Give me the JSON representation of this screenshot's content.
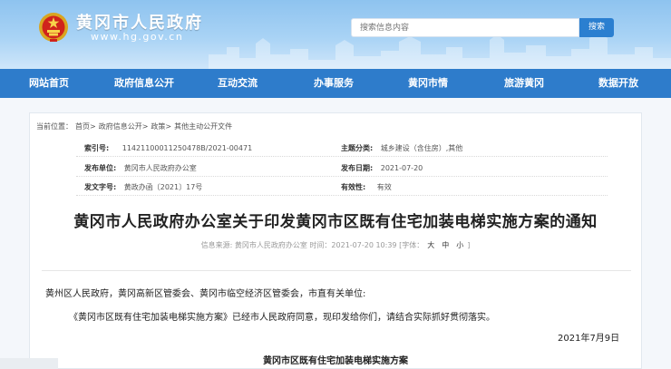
{
  "header": {
    "site_title": "黄冈市人民政府",
    "site_url": "www.hg.gov.cn",
    "search_placeholder": "搜索信息内容",
    "search_button": "搜索"
  },
  "nav": {
    "items": [
      "网站首页",
      "政府信息公开",
      "互动交流",
      "办事服务",
      "黄冈市情",
      "旅游黄冈",
      "数据开放"
    ]
  },
  "breadcrumb": {
    "prefix": "当前位置：",
    "items": [
      "首页>",
      "政府信息公开>",
      "政策>",
      "其他主动公开文件"
    ]
  },
  "meta": {
    "index_label": "索引号:",
    "index_value": "11421100011250478B/2021-00471",
    "topic_label": "主题分类:",
    "topic_value": "城乡建设（含住房）,其他",
    "issuer_label": "发布单位:",
    "issuer_value": "黄冈市人民政府办公室",
    "date_label": "发布日期:",
    "date_value": "2021-07-20",
    "docno_label": "发文字号:",
    "docno_value": "黄政办函〔2021〕17号",
    "validity_label": "有效性:",
    "validity_value": "有效"
  },
  "document": {
    "title": "黄冈市人民政府办公室关于印发黄冈市区既有住宅加装电梯实施方案的通知",
    "source": "信息来源:  黄冈市人民政府办公室   时间：2021-07-20 10:39  [字体：",
    "font_large": "大",
    "font_medium": "中",
    "font_small": "小",
    "font_close": "]",
    "salutation": "黄州区人民政府，黄冈高新区管委会、黄冈市临空经济区管委会，市直有关单位:",
    "paragraph": "《黄冈市区既有住宅加装电梯实施方案》已经市人民政府同意，现印发给你们，请结合实际抓好贯彻落实。",
    "date": "2021年7月9日",
    "attachment_title": "黄冈市区既有住宅加装电梯实施方案"
  },
  "colors": {
    "nav_bg": "#2e7ccb",
    "header_bg": "#a9d3f5",
    "search_button_bg": "#2b7fd0"
  }
}
